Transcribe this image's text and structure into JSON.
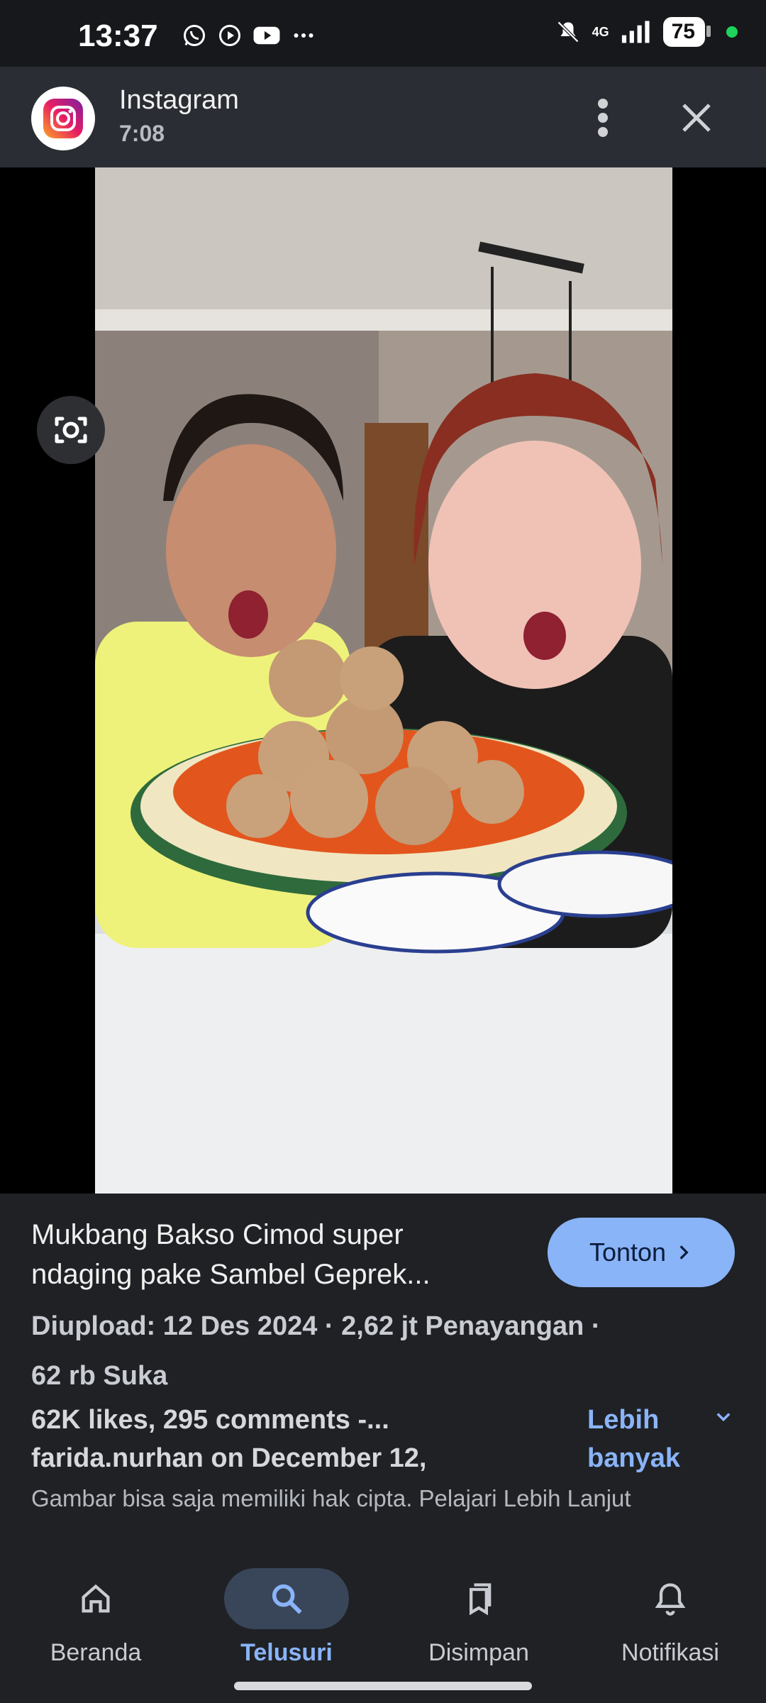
{
  "status_bar": {
    "time": "13:37",
    "left_icons": [
      "whatsapp-icon",
      "play-icon",
      "youtube-icon",
      "more-dots-icon"
    ],
    "network": "4G",
    "battery": "75"
  },
  "app_header": {
    "title": "Instagram",
    "subtitle": "7:08"
  },
  "result": {
    "title": "Mukbang Bakso Cimod super ndaging pake Sambel Geprek...",
    "watch_label": "Tonton",
    "meta_line1": "Diupload: 12 Des 2024 · 2,62 jt Penayangan ·",
    "meta_line2": "62 rb Suka",
    "description": "62K likes, 295 comments -... farida.nurhan on December 12,",
    "more_label": "Lebih banyak",
    "copyright": "Gambar bisa saja memiliki hak cipta. Pelajari Lebih Lanjut"
  },
  "bottom_nav": {
    "items": [
      {
        "label": "Beranda",
        "icon": "home-icon"
      },
      {
        "label": "Telusuri",
        "icon": "search-icon",
        "active": true
      },
      {
        "label": "Disimpan",
        "icon": "bookmark-icon"
      },
      {
        "label": "Notifikasi",
        "icon": "bell-icon"
      }
    ]
  },
  "colors": {
    "accent": "#8ab4f8",
    "background": "#1f2125",
    "header": "#2a2d33"
  }
}
